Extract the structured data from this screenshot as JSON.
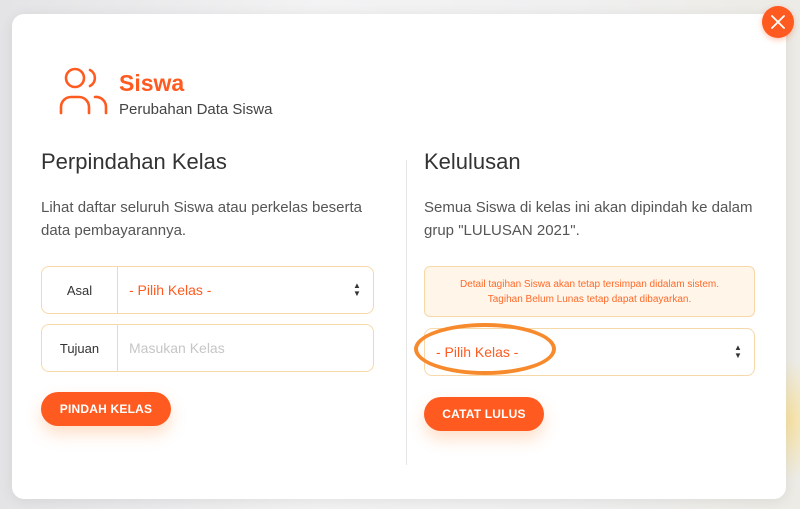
{
  "header": {
    "title": "Siswa",
    "subtitle": "Perubahan Data Siswa",
    "icon": "users-icon"
  },
  "close": {
    "icon": "close-icon"
  },
  "left": {
    "title": "Perpindahan Kelas",
    "description": "Lihat daftar seluruh Siswa atau perkelas beserta data pembayarannya.",
    "asal": {
      "label": "Asal",
      "value": "- Pilih Kelas -"
    },
    "tujuan": {
      "label": "Tujuan",
      "placeholder": "Masukan Kelas"
    },
    "button": "PINDAH KELAS"
  },
  "right": {
    "title": "Kelulusan",
    "description": "Semua Siswa di kelas ini akan dipindah ke dalam grup \"LULUSAN 2021\".",
    "notice": {
      "line1": "Detail tagihan Siswa akan tetap tersimpan didalam sistem.",
      "line2": "Tagihan Belum Lunas tetap dapat dibayarkan."
    },
    "select": {
      "value": "- Pilih Kelas -"
    },
    "button": "CATAT LULUS"
  },
  "colors": {
    "accent": "#ff5a1f",
    "field_border": "#f7d9a9",
    "notice_bg": "#fff5e9",
    "highlight": "#f78a2c"
  }
}
